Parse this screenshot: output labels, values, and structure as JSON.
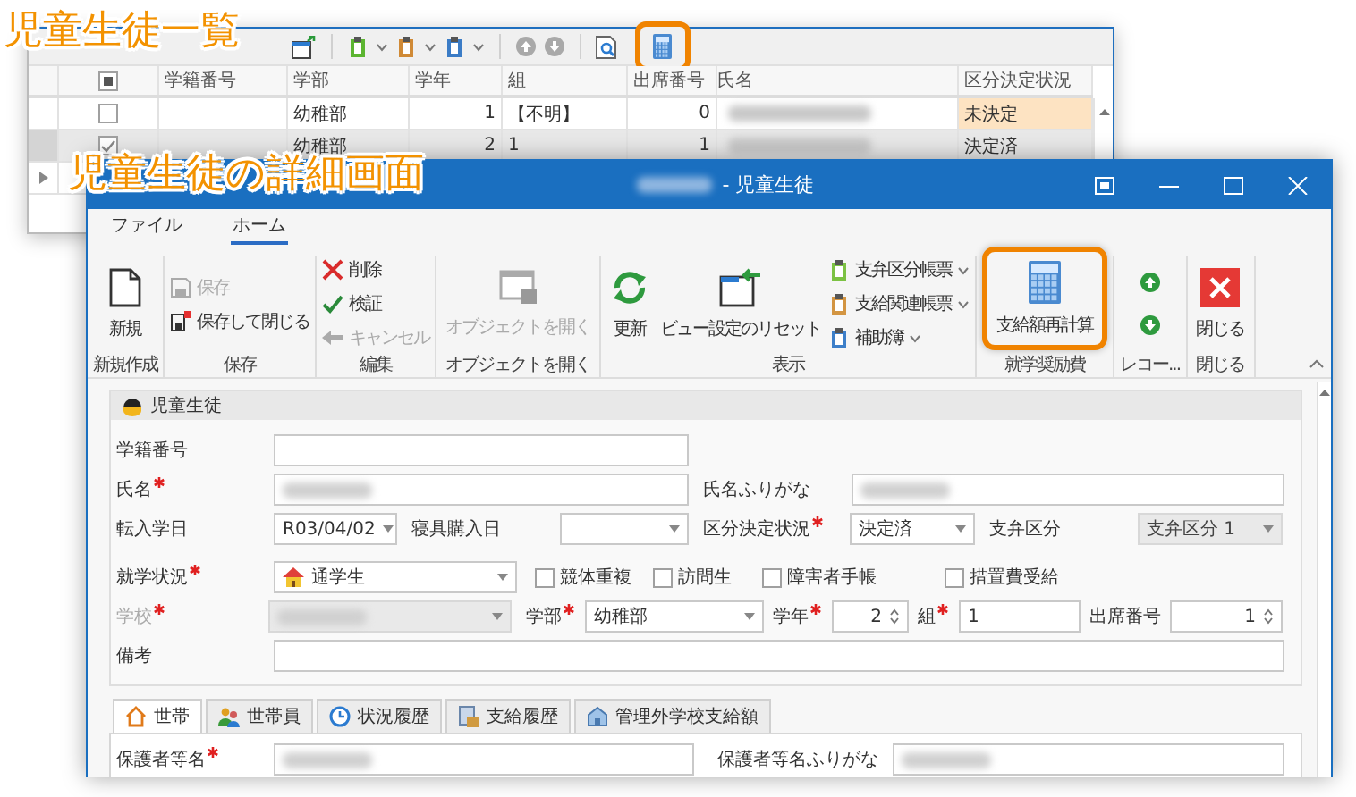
{
  "callouts": [
    {
      "text": "児童生徒一覧"
    },
    {
      "text": "児童生徒の詳細画面"
    }
  ],
  "list_window": {
    "recalculate_button": {
      "highlighted": true
    },
    "header_checkbox": {
      "indeterminate": true
    },
    "columns": [
      "学籍番号",
      "学部",
      "学年",
      "組",
      "出席番号",
      "氏名",
      "区分決定状況"
    ],
    "rows": [
      {
        "checked": false,
        "selected": false,
        "current": false,
        "department": "幼稚部",
        "grade": "1",
        "class": "【不明】",
        "attendance_no": "0",
        "status": "未決定",
        "status_highlight": true
      },
      {
        "checked": true,
        "selected": true,
        "current": false,
        "department": "幼稚部",
        "grade": "2",
        "class": "1",
        "attendance_no": "1",
        "status": "決定済",
        "status_highlight": false
      },
      {
        "selected": false,
        "current": true
      }
    ]
  },
  "detail_window": {
    "title": "- 児童生徒",
    "menu_tabs": [
      {
        "label": "ファイル",
        "selected": false
      },
      {
        "label": "ホーム",
        "selected": true
      }
    ],
    "ribbon_groups": [
      {
        "label": "新規作成",
        "items": [
          {
            "kind": "large",
            "label": "新規",
            "disabled": false,
            "highlighted": false
          }
        ]
      },
      {
        "label": "保存",
        "items": [
          {
            "kind": "small",
            "label": "保存",
            "disabled": true,
            "dropdown": false
          },
          {
            "kind": "small",
            "label": "保存して閉じる",
            "disabled": false,
            "dropdown": false
          }
        ]
      },
      {
        "label": "編集",
        "items": [
          {
            "kind": "small",
            "label": "削除",
            "disabled": false,
            "dropdown": false
          },
          {
            "kind": "small",
            "label": "検証",
            "disabled": false,
            "dropdown": false
          },
          {
            "kind": "small",
            "label": "キャンセル",
            "disabled": true,
            "dropdown": false
          }
        ]
      },
      {
        "label": "オブジェクトを開く",
        "items": [
          {
            "kind": "large",
            "label": "オブジェクトを開く",
            "disabled": true,
            "highlighted": false
          }
        ]
      },
      {
        "label": "表示",
        "items": [
          {
            "kind": "large",
            "label": "更新",
            "disabled": false,
            "highlighted": false
          },
          {
            "kind": "large",
            "label": "ビュー設定のリセット",
            "disabled": false,
            "highlighted": false
          },
          {
            "kind": "small",
            "label": "支弁区分帳票",
            "disabled": false,
            "dropdown": true
          },
          {
            "kind": "small",
            "label": "支給関連帳票",
            "disabled": false,
            "dropdown": true
          },
          {
            "kind": "small",
            "label": "補助簿",
            "disabled": false,
            "dropdown": true
          }
        ]
      },
      {
        "label": "就学奨励費",
        "items": [
          {
            "kind": "large",
            "label": "支給額再計算",
            "disabled": false,
            "highlighted": true
          }
        ]
      },
      {
        "label": "レコー...",
        "items": [
          {
            "kind": "icon"
          },
          {
            "kind": "icon"
          }
        ]
      },
      {
        "label": "閉じる",
        "items": [
          {
            "kind": "large",
            "label": "閉じる",
            "disabled": false,
            "highlighted": false
          }
        ]
      }
    ],
    "student_panel": {
      "title": "児童生徒",
      "fields": [
        {
          "kind": "text",
          "label": "学籍番号",
          "required": false,
          "label_disabled": false,
          "disabled": false
        },
        {
          "kind": "text",
          "label": "氏名",
          "required": true,
          "label_disabled": false,
          "disabled": false,
          "redacted": true
        },
        {
          "kind": "text",
          "label": "氏名ふりがな",
          "required": false,
          "label_disabled": false,
          "disabled": false,
          "redacted": true
        },
        {
          "kind": "combo",
          "label": "転入学日",
          "required": false,
          "label_disabled": false,
          "disabled": false,
          "value": "R03/04/02"
        },
        {
          "kind": "combo",
          "label": "寝具購入日",
          "required": false,
          "label_disabled": false,
          "disabled": false
        },
        {
          "kind": "combo",
          "label": "区分決定状況",
          "required": true,
          "label_disabled": false,
          "disabled": false,
          "value": "決定済"
        },
        {
          "kind": "combo",
          "label": "支弁区分",
          "required": false,
          "label_disabled": false,
          "disabled": true,
          "value": "支弁区分 1"
        },
        {
          "kind": "icon_combo",
          "label": "就学状況",
          "required": true,
          "label_disabled": false,
          "disabled": false,
          "value": "通学生"
        },
        {
          "kind": "checkbox",
          "label": "競体重複",
          "checked": false
        },
        {
          "kind": "checkbox",
          "label": "訪問生",
          "checked": false
        },
        {
          "kind": "checkbox",
          "label": "障害者手帳",
          "checked": false
        },
        {
          "kind": "checkbox",
          "label": "措置費受給",
          "checked": false
        },
        {
          "kind": "combo",
          "label": "学校",
          "required": true,
          "label_disabled": true,
          "disabled": true,
          "redacted": true
        },
        {
          "kind": "combo",
          "label": "学部",
          "required": true,
          "label_disabled": false,
          "disabled": false,
          "value": "幼稚部"
        },
        {
          "kind": "spinner",
          "label": "学年",
          "required": true,
          "label_disabled": false,
          "disabled": false,
          "value": "2"
        },
        {
          "kind": "text",
          "label": "組",
          "required": true,
          "label_disabled": false,
          "disabled": false,
          "value": "1"
        },
        {
          "kind": "spinner",
          "label": "出席番号",
          "required": false,
          "label_disabled": false,
          "disabled": false,
          "value": "1"
        },
        {
          "kind": "text",
          "label": "備考",
          "required": false,
          "label_disabled": false,
          "disabled": false
        }
      ]
    },
    "tabs": [
      {
        "label": "世帯",
        "selected": true
      },
      {
        "label": "世帯員",
        "selected": false
      },
      {
        "label": "状況履歴",
        "selected": false
      },
      {
        "label": "支給履歴",
        "selected": false
      },
      {
        "label": "管理外学校支給額",
        "selected": false
      }
    ],
    "household": {
      "fields": [
        {
          "kind": "text",
          "label": "保護者等名",
          "required": true,
          "label_disabled": false,
          "disabled": false,
          "redacted": true
        },
        {
          "kind": "text",
          "label": "保護者等名ふりがな",
          "required": false,
          "label_disabled": false,
          "disabled": false,
          "redacted": true
        }
      ]
    }
  }
}
